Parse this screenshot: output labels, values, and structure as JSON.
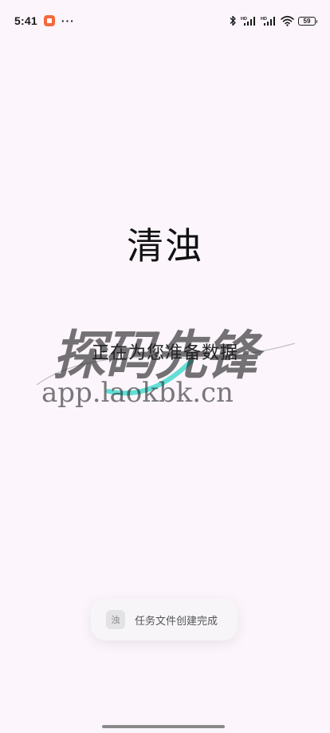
{
  "status_bar": {
    "time": "5:41",
    "more": "···",
    "battery": "59",
    "signal_1_tag": "HD",
    "signal_2_tag": "HD"
  },
  "main": {
    "app_title": "清浊",
    "loading_text": "正在为您准备数据"
  },
  "watermark": {
    "logo_text": "探码先锋",
    "url": "app.laokbk.cn",
    "arc_colors": [
      "#2fd6c8",
      "#9a9a9a"
    ]
  },
  "toast": {
    "icon_char": "浊",
    "message": "任务文件创建完成"
  },
  "colors": {
    "background": "#fcf6fc",
    "app_notif": "#f26a3c"
  }
}
